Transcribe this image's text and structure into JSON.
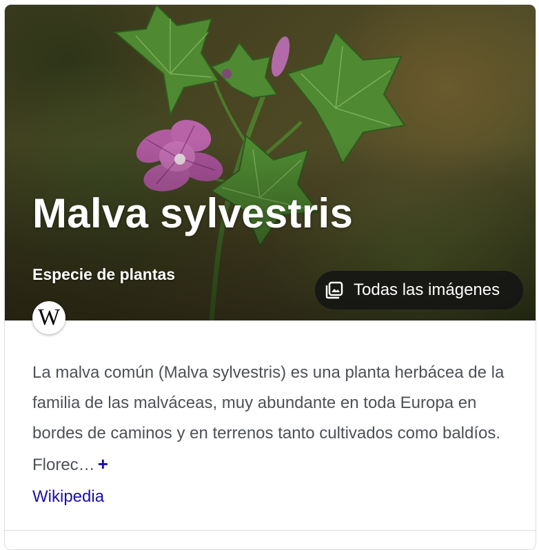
{
  "panel": {
    "title": "Malva sylvestris",
    "subtitle": "Especie de plantas",
    "images_button_label": "Todas las imágenes",
    "images_button_icon": "image-gallery-icon",
    "source_badge_letter": "W",
    "source_badge_icon": "wikipedia-icon",
    "description": "La malva común (Malva sylvestris) es una planta herbácea de la familia de las malváceas, muy abundante en toda Europa en bordes de caminos y en terrenos tanto cultivados como baldíos. Florec…",
    "more_symbol": "+",
    "source_link_label": "Wikipedia"
  },
  "colors": {
    "link": "#1a0dab",
    "body_text": "#4d5156",
    "flower": "#b05aa0",
    "leaf": "#3f6e2a"
  }
}
